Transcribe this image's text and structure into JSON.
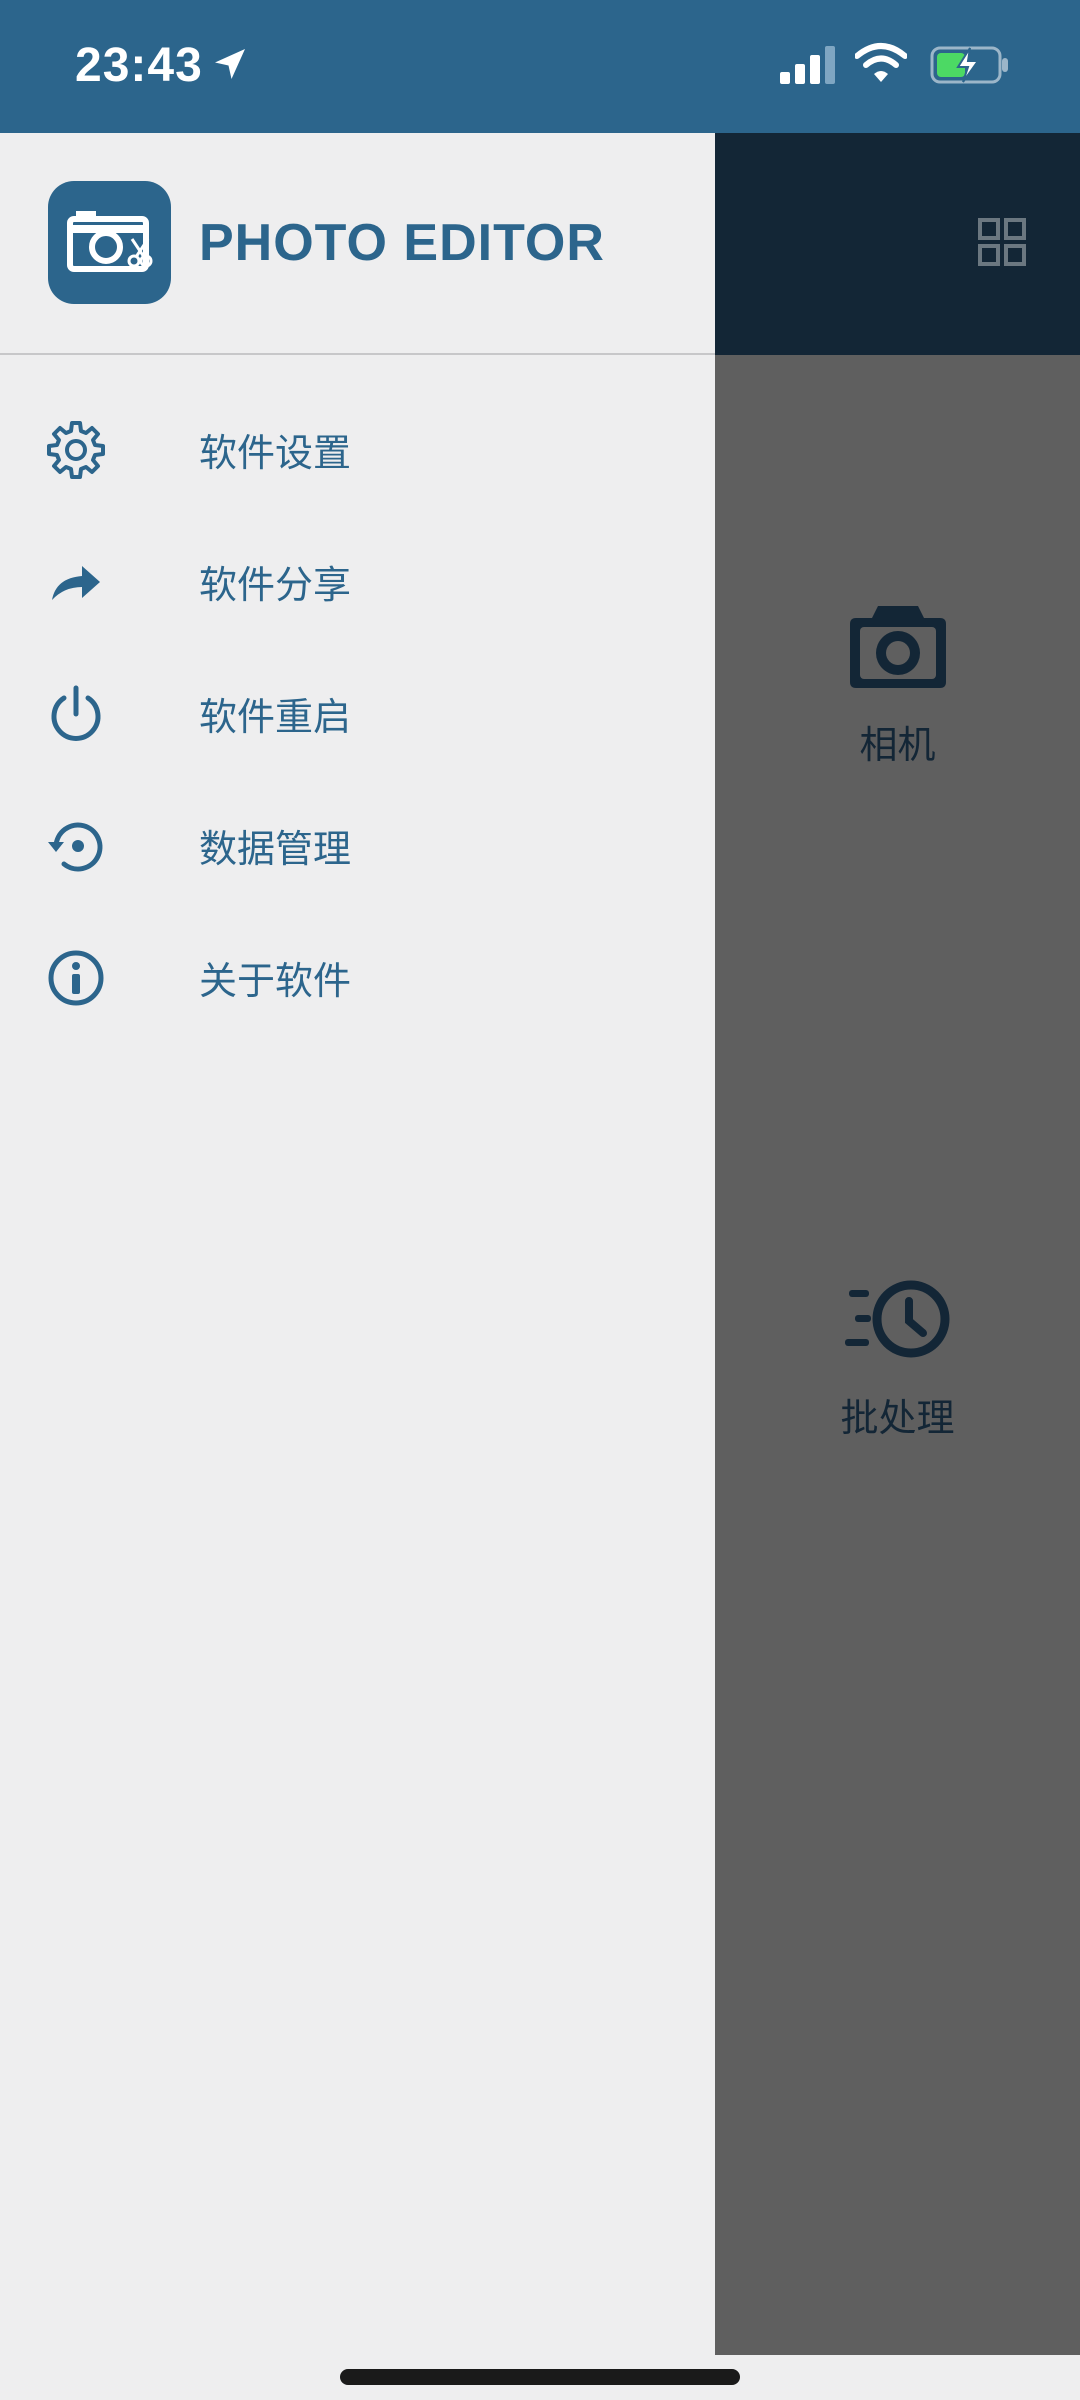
{
  "status_bar": {
    "time": "23:43",
    "color": "#2c658c"
  },
  "drawer": {
    "app_title": "PHOTO EDITOR",
    "accent": "#2c658c",
    "items": [
      {
        "label": "软件设置",
        "icon": "gear-icon"
      },
      {
        "label": "软件分享",
        "icon": "share-icon"
      },
      {
        "label": "软件重启",
        "icon": "power-icon"
      },
      {
        "label": "数据管理",
        "icon": "restore-icon"
      },
      {
        "label": "关于软件",
        "icon": "info-icon"
      }
    ]
  },
  "main": {
    "toolbar_icon": "grid-icon",
    "tiles": [
      {
        "label": "相机",
        "icon": "camera-icon"
      },
      {
        "label": "批处理",
        "icon": "batch-clock-icon"
      }
    ]
  }
}
